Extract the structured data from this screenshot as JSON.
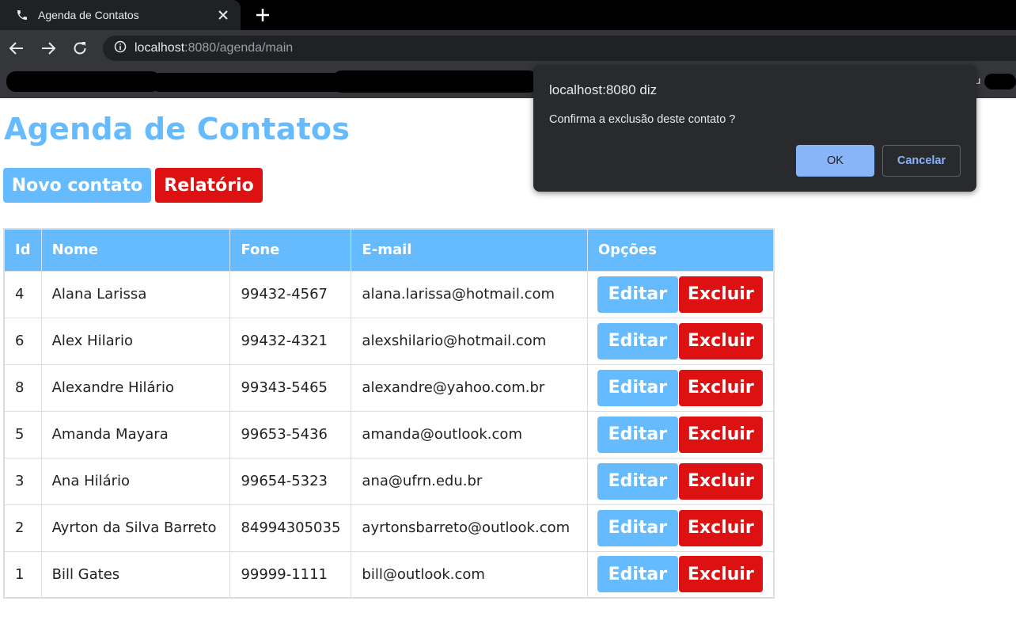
{
  "browser": {
    "tab_title": "Agenda de Contatos",
    "url_host": "localhost",
    "url_path": ":8080/agenda/main",
    "bookmark_stub": "u"
  },
  "page": {
    "title": "Agenda de Contatos",
    "new_contact_label": "Novo contato",
    "report_label": "Relatório"
  },
  "table": {
    "headers": [
      "Id",
      "Nome",
      "Fone",
      "E-mail",
      "Opções"
    ],
    "edit_label": "Editar",
    "delete_label": "Excluir",
    "rows": [
      {
        "id": "4",
        "name": "Alana Larissa",
        "phone": "99432-4567",
        "email": "alana.larissa@hotmail.com"
      },
      {
        "id": "6",
        "name": "Alex Hilario",
        "phone": "99432-4321",
        "email": "alexshilario@hotmail.com"
      },
      {
        "id": "8",
        "name": "Alexandre Hilário",
        "phone": "99343-5465",
        "email": "alexandre@yahoo.com.br"
      },
      {
        "id": "5",
        "name": "Amanda Mayara",
        "phone": "99653-5436",
        "email": "amanda@outlook.com"
      },
      {
        "id": "3",
        "name": "Ana Hilário",
        "phone": "99654-5323",
        "email": "ana@ufrn.edu.br"
      },
      {
        "id": "2",
        "name": "Ayrton da Silva Barreto",
        "phone": "84994305035",
        "email": "ayrtonsbarreto@outlook.com"
      },
      {
        "id": "1",
        "name": "Bill Gates",
        "phone": "99999-1111",
        "email": "bill@outlook.com"
      }
    ]
  },
  "dialog": {
    "title": "localhost:8080 diz",
    "message": "Confirma a exclusão deste contato ?",
    "ok_label": "OK",
    "cancel_label": "Cancelar"
  },
  "colors": {
    "accent_blue": "#66bbff",
    "danger_red": "#dd1111",
    "dialog_bg": "#292a2d",
    "dialog_ok": "#8ab4f8"
  },
  "icons": {
    "tab": "phone-icon",
    "close": "close-icon",
    "new_tab": "plus-icon",
    "back": "back-arrow-icon",
    "forward": "forward-arrow-icon",
    "reload": "reload-icon",
    "site_info": "info-icon"
  }
}
